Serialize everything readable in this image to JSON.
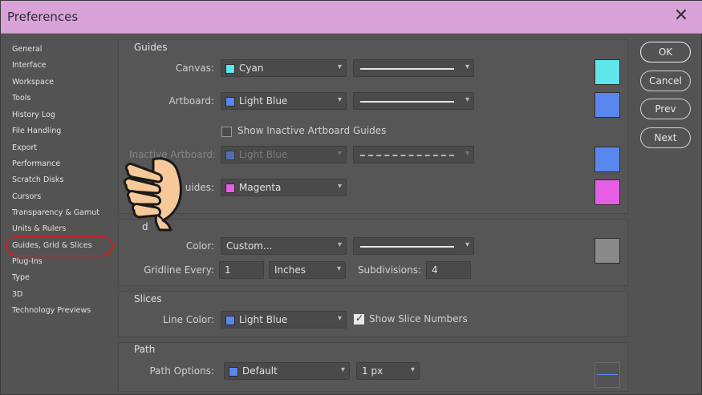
{
  "window": {
    "title": "Preferences",
    "close_glyph": "✕"
  },
  "sidebar": {
    "items": [
      "General",
      "Interface",
      "Workspace",
      "Tools",
      "History Log",
      "File Handling",
      "Export",
      "Performance",
      "Scratch Disks",
      "Cursors",
      "Transparency & Gamut",
      "Units & Rulers",
      "Guides, Grid & Slices",
      "Plug-Ins",
      "Type",
      "3D",
      "Technology Previews"
    ],
    "selected": "Guides, Grid & Slices"
  },
  "guides": {
    "title": "Guides",
    "canvas_label": "Canvas:",
    "canvas_color": "Cyan",
    "artboard_label": "Artboard:",
    "artboard_color": "Light Blue",
    "show_inactive_label": "Show Inactive Artboard Guides",
    "inactive_label": "Inactive Artboard:",
    "inactive_color": "Light Blue",
    "smart_label": "uides:",
    "smart_color": "Magenta"
  },
  "grid": {
    "title": "d",
    "color_label": "Color:",
    "color_value": "Custom...",
    "gridline_label": "Gridline Every:",
    "gridline_value": "1",
    "unit_value": "Inches",
    "subdivisions_label": "Subdivisions:",
    "subdivisions_value": "4"
  },
  "slices": {
    "title": "Slices",
    "line_color_label": "Line Color:",
    "line_color": "Light Blue",
    "show_numbers_label": "Show Slice Numbers"
  },
  "path": {
    "title": "Path",
    "options_label": "Path Options:",
    "options_color": "Default",
    "width_value": "1 px"
  },
  "buttons": {
    "ok": "OK",
    "cancel": "Cancel",
    "prev": "Prev",
    "next": "Next"
  },
  "colors": {
    "cyan": "#5ee6ea",
    "light_blue": "#5a86f0",
    "magenta": "#e55ee5",
    "custom_gray": "#8a8a8a",
    "titlebar": "#d9a3da",
    "highlight_ring": "#c3242c"
  },
  "icons": {
    "chevron": "chevron-down-icon",
    "close": "close-icon",
    "pointer": "pointing-hand-icon"
  }
}
